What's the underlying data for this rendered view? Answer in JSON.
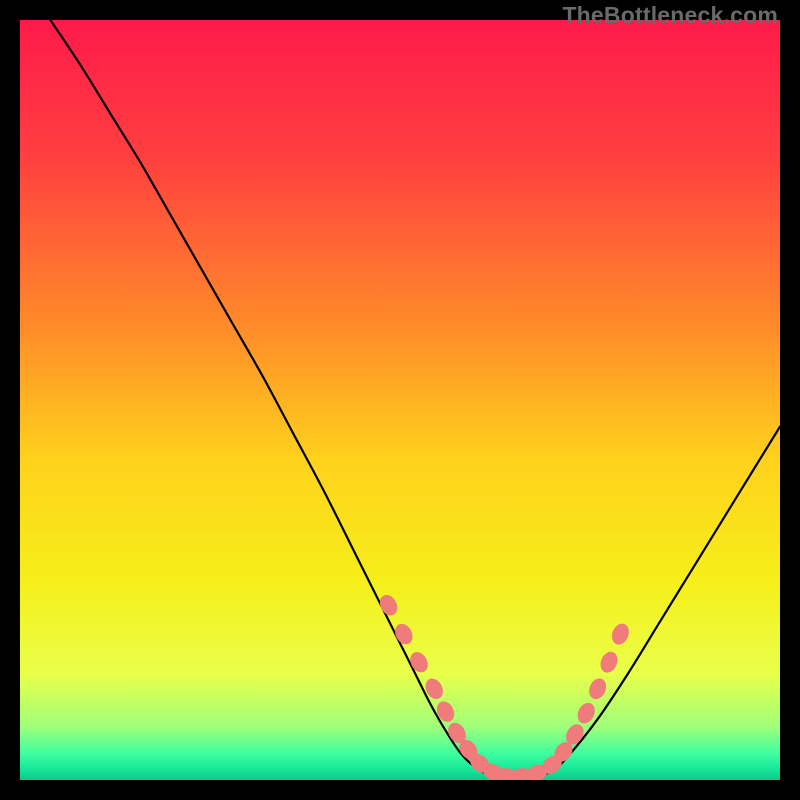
{
  "watermark": "TheBottleneck.com",
  "chart_data": {
    "type": "line",
    "title": "",
    "xlabel": "",
    "ylabel": "",
    "xlim": [
      0,
      100
    ],
    "ylim": [
      0,
      100
    ],
    "background_gradient": {
      "stops": [
        {
          "offset": 0.0,
          "color": "#ff1a4b"
        },
        {
          "offset": 0.18,
          "color": "#ff3f3f"
        },
        {
          "offset": 0.4,
          "color": "#ff8a2a"
        },
        {
          "offset": 0.58,
          "color": "#ffd21c"
        },
        {
          "offset": 0.74,
          "color": "#f6ef1a"
        },
        {
          "offset": 0.86,
          "color": "#e9ff4a"
        },
        {
          "offset": 0.93,
          "color": "#9fff7a"
        },
        {
          "offset": 0.965,
          "color": "#3fffa0"
        },
        {
          "offset": 0.985,
          "color": "#18e89a"
        },
        {
          "offset": 1.0,
          "color": "#0fc98c"
        }
      ]
    },
    "series": [
      {
        "name": "bottleneck-curve",
        "color": "#000000",
        "x": [
          4,
          8,
          12,
          16,
          20,
          24,
          28,
          32,
          36,
          40,
          44,
          48,
          52,
          54,
          56,
          58,
          60,
          62,
          64,
          66,
          68,
          70,
          72,
          76,
          80,
          84,
          88,
          92,
          96,
          100
        ],
        "y": [
          100,
          94,
          87.5,
          81,
          74,
          67,
          60,
          53,
          45.5,
          38,
          30,
          22,
          14,
          10,
          6.5,
          3.5,
          1.6,
          0.6,
          0.2,
          0.15,
          0.4,
          1.2,
          3,
          8,
          14,
          20.5,
          27,
          33.5,
          40,
          46.5
        ]
      }
    ],
    "marker_points": {
      "name": "highlight-dots",
      "color": "#ef7b7b",
      "radius": 8,
      "stretch": 1.35,
      "x": [
        48.5,
        50.5,
        52.5,
        54.5,
        56,
        57.5,
        59,
        60.5,
        62.3,
        64,
        66,
        68,
        70,
        71.5,
        73,
        74.5,
        76,
        77.5,
        79
      ],
      "y": [
        23,
        19.2,
        15.5,
        12,
        9,
        6.2,
        4,
        2.2,
        1,
        0.5,
        0.5,
        0.9,
        2,
        3.7,
        6,
        8.8,
        12,
        15.5,
        19.2
      ]
    }
  }
}
